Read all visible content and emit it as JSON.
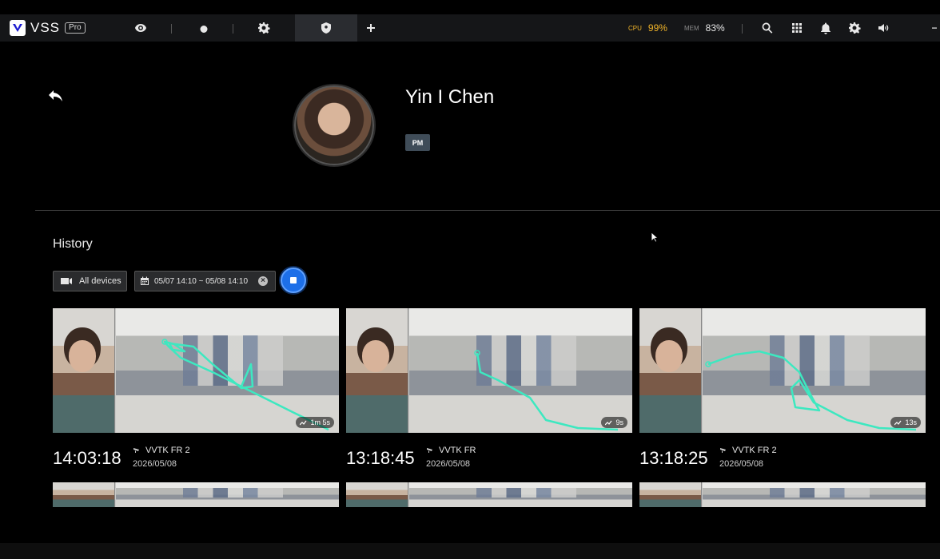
{
  "topbar": {
    "app_name": "VSS",
    "edition": "Pro",
    "cpu_label": "CPU",
    "cpu_value": "99%",
    "mem_label": "MEM",
    "mem_value": "83%"
  },
  "profile": {
    "name": "Yin I Chen",
    "role": "PM"
  },
  "history": {
    "title": "History",
    "device_filter": "All devices",
    "date_range": "05/07 14:10 ~ 05/08 14:10",
    "items": [
      {
        "time": "14:03:18",
        "camera": "VVTK FR 2",
        "date": "2026/05/08",
        "duration": "1m 5s"
      },
      {
        "time": "13:18:45",
        "camera": "VVTK FR",
        "date": "2026/05/08",
        "duration": "9s"
      },
      {
        "time": "13:18:25",
        "camera": "VVTK FR 2",
        "date": "2026/05/08",
        "duration": "13s"
      }
    ]
  },
  "colors": {
    "accent": "#1d6fe8",
    "track": "#3de8c0",
    "cpu_warning": "#f0b429",
    "badge": "#3f4c58"
  },
  "icons": {
    "nav": [
      "eye-icon",
      "layers-icon",
      "settings-gear-icon",
      "shield-user-icon",
      "plus-icon"
    ],
    "tools": [
      "search-icon",
      "grid-icon",
      "bell-icon",
      "gear-icon",
      "volume-icon",
      "minimize-icon"
    ]
  }
}
